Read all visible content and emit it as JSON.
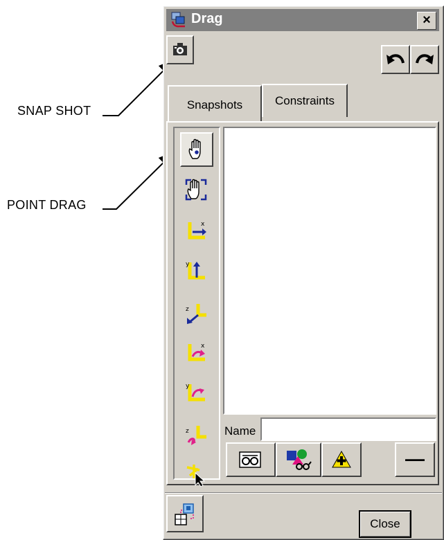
{
  "callouts": {
    "snapshot": "SNAP SHOT",
    "point_drag": "POINT DRAG"
  },
  "window": {
    "title": "Drag",
    "close_glyph": "×"
  },
  "toolbar": {
    "snapshot_icon": "camera-icon",
    "undo_icon": "undo-arrow-icon",
    "redo_icon": "redo-arrow-icon"
  },
  "tabs": [
    {
      "label": "Snapshots",
      "selected": true
    },
    {
      "label": "Constraints",
      "selected": false
    }
  ],
  "tools": [
    {
      "name": "point-drag-hand",
      "state": "active"
    },
    {
      "name": "object-drag-hand",
      "state": "normal"
    },
    {
      "name": "translate-x",
      "state": "normal",
      "axis": "x"
    },
    {
      "name": "translate-y",
      "state": "normal",
      "axis": "y"
    },
    {
      "name": "translate-z",
      "state": "normal",
      "axis": "z"
    },
    {
      "name": "rotate-x",
      "state": "normal",
      "axis": "x"
    },
    {
      "name": "rotate-y",
      "state": "normal",
      "axis": "y"
    },
    {
      "name": "rotate-z",
      "state": "normal",
      "axis": "z"
    },
    {
      "name": "select-pointer",
      "state": "normal"
    }
  ],
  "snapshot_list": [],
  "name_field": {
    "label": "Name",
    "value": ""
  },
  "list_buttons": {
    "view_icon": "glasses-view-icon",
    "apply_icon": "shapes-glasses-icon",
    "add_icon": "add-plus-icon",
    "remove_glyph": "—"
  },
  "footer": {
    "animate_icon": "cubes-icon",
    "close_label": "Close"
  },
  "colors": {
    "face": "#d4d0c8",
    "titlebar": "#808080",
    "axis_yellow": "#f5e000",
    "axis_blue": "#1a2a9a",
    "axis_magenta": "#e0208a"
  }
}
